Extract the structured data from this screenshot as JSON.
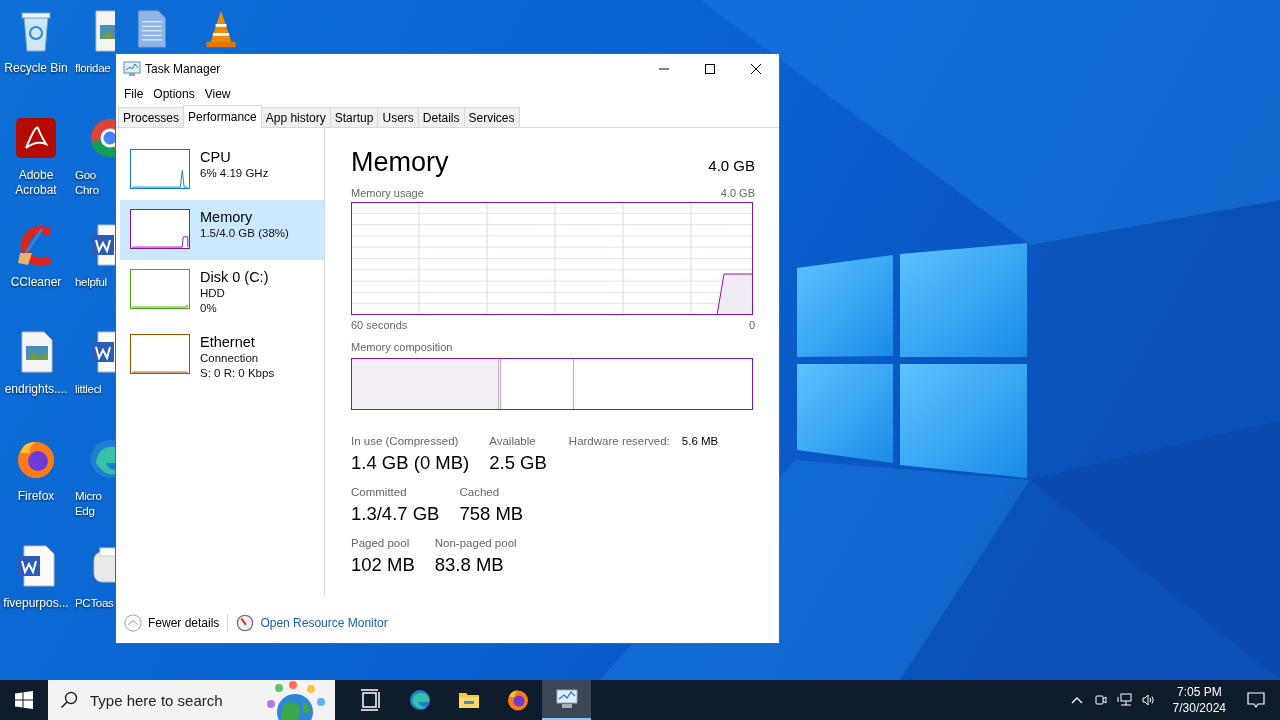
{
  "desktop": {
    "columns": [
      [
        {
          "kind": "recycle-bin",
          "lines": [
            "Recycle Bin"
          ]
        },
        {
          "kind": "pdf",
          "lines": [
            "Adobe",
            "Acrobat"
          ]
        },
        {
          "kind": "ccleaner",
          "lines": [
            "CCleaner"
          ]
        },
        {
          "kind": "image-doc",
          "lines": [
            "endrights...."
          ]
        },
        {
          "kind": "firefox",
          "lines": [
            "Firefox"
          ]
        },
        {
          "kind": "word",
          "lines": [
            "fivepurpos..."
          ]
        }
      ],
      [
        {
          "kind": "image-doc",
          "lines": [
            "floridae"
          ]
        },
        {
          "kind": "chrome",
          "lines": [
            "Goo",
            "Chro"
          ]
        },
        {
          "kind": "word",
          "lines": [
            "helpful"
          ]
        },
        {
          "kind": "word",
          "lines": [
            "littlecl"
          ]
        },
        {
          "kind": "edge",
          "lines": [
            "Micro",
            "Edg"
          ]
        },
        {
          "kind": "printer",
          "lines": [
            "PCToas"
          ]
        }
      ],
      [
        {
          "kind": "text-doc"
        }
      ],
      [
        {
          "kind": "vlc"
        }
      ]
    ]
  },
  "window": {
    "title": "Task Manager",
    "menu": [
      "File",
      "Options",
      "View"
    ],
    "tabs": [
      {
        "label": "Processes",
        "selected": false
      },
      {
        "label": "Performance",
        "selected": true
      },
      {
        "label": "App history",
        "selected": false
      },
      {
        "label": "Startup",
        "selected": false
      },
      {
        "label": "Users",
        "selected": false
      },
      {
        "label": "Details",
        "selected": false
      },
      {
        "label": "Services",
        "selected": false
      }
    ],
    "resources": [
      {
        "kind": "cpu",
        "name": "CPU",
        "lines": [
          "6%  4.19 GHz"
        ],
        "color": "#117dbb",
        "selected": false
      },
      {
        "kind": "memory",
        "name": "Memory",
        "lines": [
          "1.5/4.0 GB (38%)"
        ],
        "color": "#8b12ae",
        "selected": true
      },
      {
        "kind": "disk",
        "name": "Disk 0 (C:)",
        "lines": [
          "HDD",
          "0%"
        ],
        "color": "#4da60c",
        "selected": false
      },
      {
        "kind": "network",
        "name": "Ethernet",
        "lines": [
          "Connection",
          "S: 0 R: 0 Kbps"
        ],
        "color": "#a74f01",
        "selected": false
      }
    ],
    "detail": {
      "title": "Memory",
      "total": "4.0 GB",
      "usage_label": "Memory usage",
      "usage_max": "4.0 GB",
      "time_start": "60 seconds",
      "time_end": "0",
      "composition_label": "Memory composition",
      "stats": [
        [
          {
            "kind": "big",
            "label": "In use (Compressed)",
            "value": "1.4 GB (0 MB)"
          },
          {
            "kind": "big",
            "label": "Available",
            "value": "2.5 GB"
          },
          {
            "kind": "inline",
            "label": "Hardware reserved:",
            "value": "5.6 MB"
          }
        ],
        [
          {
            "kind": "big",
            "label": "Committed",
            "value": "1.3/4.7 GB"
          },
          {
            "kind": "big",
            "label": "Cached",
            "value": "758 MB"
          }
        ],
        [
          {
            "kind": "big",
            "label": "Paged pool",
            "value": "102 MB"
          },
          {
            "kind": "big",
            "label": "Non-paged pool",
            "value": "83.8 MB"
          }
        ]
      ]
    },
    "footer": {
      "fewer_details": "Fewer details",
      "resource_monitor": "Open Resource Monitor"
    }
  },
  "taskbar": {
    "search_placeholder": "Type here to search",
    "apps": [
      {
        "kind": "task-view",
        "active": false
      },
      {
        "kind": "edge",
        "active": false
      },
      {
        "kind": "folder",
        "active": false
      },
      {
        "kind": "firefox",
        "active": false
      },
      {
        "kind": "task-manager",
        "active": true
      }
    ],
    "time": "7:05 PM",
    "date": "7/30/2024"
  }
}
